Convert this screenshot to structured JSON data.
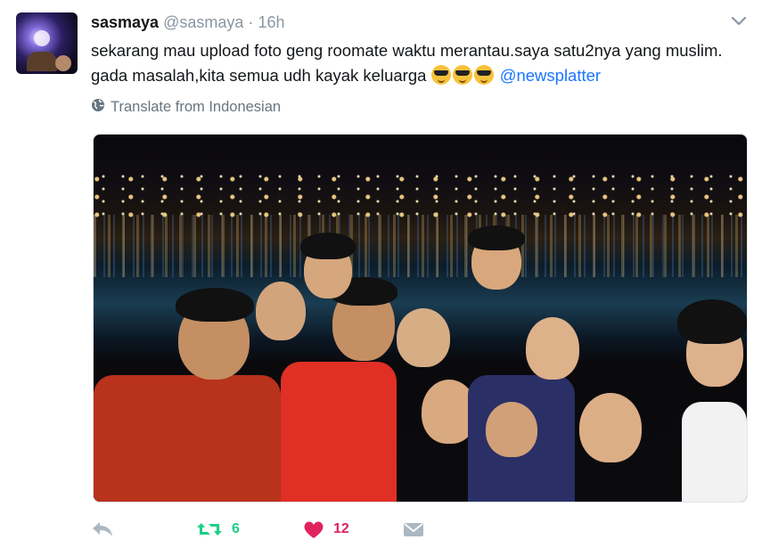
{
  "tweet": {
    "name": "sasmaya",
    "handle": "@sasmaya",
    "separator": "·",
    "time": "16h",
    "text_main": "sekarang mau upload foto geng roomate waktu merantau.saya satu2nya yang muslim. gada masalah,kita semua udh kayak keluarga ",
    "mention": "@newsplatter",
    "translate_label": "Translate from Indonesian",
    "retweet_count": "6",
    "like_count": "12"
  },
  "icons": {
    "caret": "chevron-down-icon",
    "translate": "globe-icon",
    "reply": "reply-icon",
    "retweet": "retweet-icon",
    "like": "heart-icon",
    "dm": "envelope-icon"
  },
  "colors": {
    "text": "#14171a",
    "secondary": "#8a96a3",
    "link": "#1b76ff",
    "retweet": "#19cf86",
    "like": "#e0245e"
  }
}
